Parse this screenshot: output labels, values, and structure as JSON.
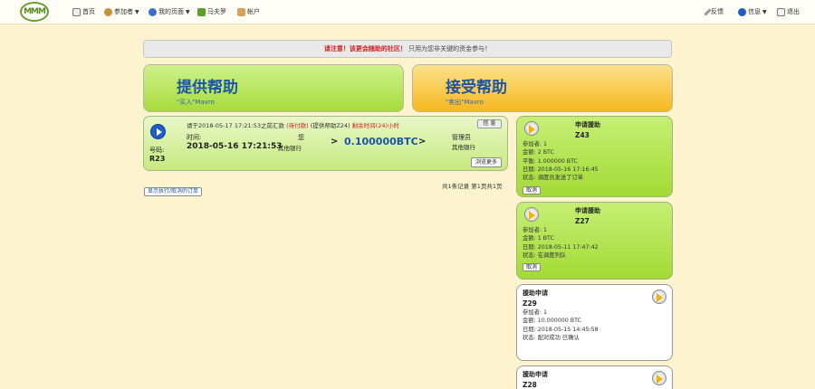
{
  "nav": {
    "logo_text": "MMM",
    "home": "首页",
    "participants": "参加者",
    "my_page": "我的页面",
    "mavro": "马夫罗",
    "account": "帐户",
    "feedback": "反馈",
    "info": "信息",
    "logout": "退出"
  },
  "notice": {
    "warning": "请注意！该更会随助的社区！",
    "rest": "只用为您非关键的资金参与！"
  },
  "provide_help": {
    "title": "提供帮助",
    "subtitle": "\"买入\"Mavro"
  },
  "receive_help": {
    "title": "接受帮助",
    "subtitle": "\"卖出\"Mavro"
  },
  "request": {
    "line_black": "请于2018-05-17 17:21:53之前汇款",
    "line_red1": "(待付款)",
    "line_black2": "(提供帮助Z24)",
    "line_red2": "剩余时间(24)小时",
    "number_label": "号码:",
    "number_value": "R23",
    "date_label": "时间:",
    "date_value": "2018-05-16 17:21:53",
    "you_label": "您",
    "bank1": "其他银行",
    "arrow": ">",
    "amount": "0.100000BTC",
    "manager_label": "管理员",
    "bank2": "其他银行",
    "info_btn": "信 息",
    "more_btn": "浏览更多"
  },
  "pager": "共1条记录 第1页共1页",
  "show_all_btn": "显示执行/取消的订单",
  "cards": [
    {
      "title": "申请援助",
      "code": "Z43",
      "rows": [
        "参加者: 1",
        "金额: 2 BTC",
        "平衡: 1.000000 BTC",
        "日期: 2018-05-16 17:16:45",
        "状态: 调度员发送了订单"
      ],
      "button": "取消"
    },
    {
      "title": "申请援助",
      "code": "Z27",
      "rows": [
        "参加者: 1",
        "金额: 1 BTC",
        "日期: 2018-05-11 17:47:42",
        "状态: 在调度列队"
      ],
      "button": "取消"
    },
    {
      "title": "援助申请",
      "code": "Z29",
      "rows": [
        "参加者: 1",
        "金额: 10.000000 BTC",
        "日期: 2018-05-15 14:45:58",
        "状态: 配对成功 已确认"
      ]
    },
    {
      "title": "援助申请",
      "code": "Z28",
      "rows": []
    }
  ]
}
